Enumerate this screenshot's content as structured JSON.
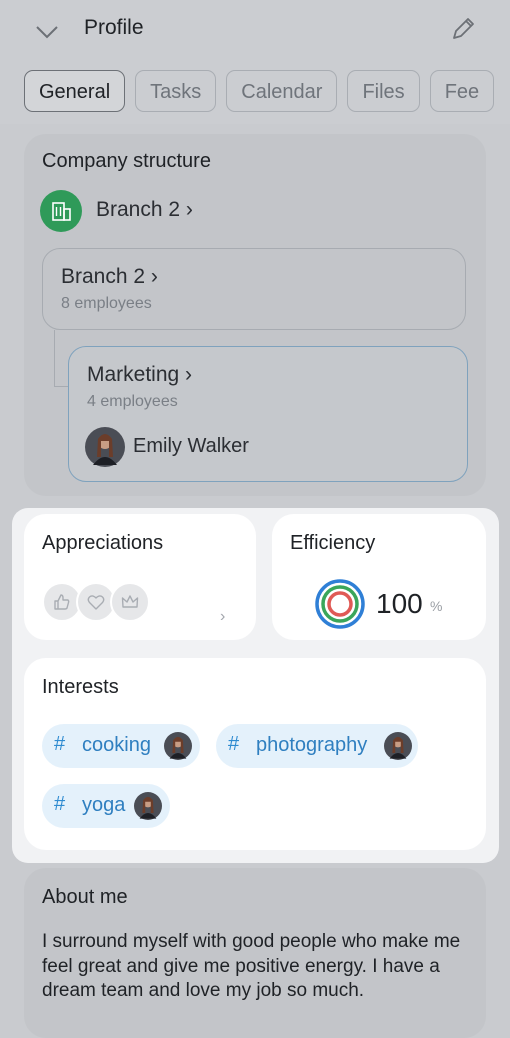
{
  "header": {
    "title": "Profile",
    "tabs": [
      "General",
      "Tasks",
      "Calendar",
      "Files",
      "Fee"
    ]
  },
  "company": {
    "heading": "Company structure",
    "branch_link": "Branch 2",
    "branch_box": {
      "name": "Branch 2",
      "employees": "8 employees"
    },
    "department": {
      "name": "Marketing",
      "employees": "4 employees",
      "member": "Emily Walker"
    }
  },
  "appreciations": {
    "heading": "Appreciations",
    "icons": [
      "thumbs-up-icon",
      "heart-icon",
      "crown-icon"
    ]
  },
  "efficiency": {
    "heading": "Efficiency",
    "value": "100",
    "unit": "%"
  },
  "interests": {
    "heading": "Interests",
    "tags": [
      "cooking",
      "photography",
      "yoga"
    ]
  },
  "about": {
    "heading": "About me",
    "text": "I surround myself with good people who make me feel great and give me positive energy. I have a dream team and love my job so much."
  },
  "colors": {
    "accent": "#2f8bd0",
    "branch_icon_bg": "#2f9a59",
    "ring_blue": "#2f7fd6",
    "ring_green": "#3aa65a",
    "ring_red": "#e05a55"
  }
}
